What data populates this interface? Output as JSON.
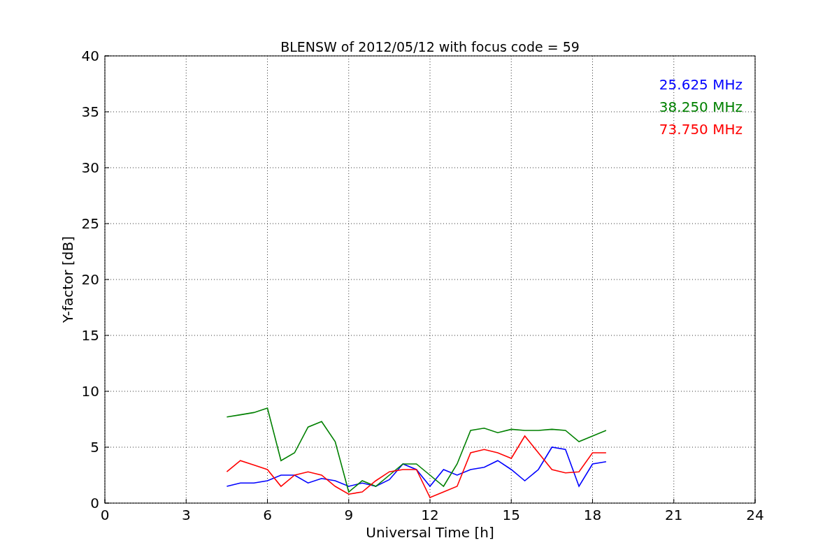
{
  "chart_data": {
    "type": "line",
    "title": "BLENSW of 2012/05/12 with focus code = 59",
    "xlabel": "Universal Time [h]",
    "ylabel": "Y-factor [dB]",
    "x": [
      4.5,
      5,
      5.5,
      6,
      6.5,
      7,
      7.5,
      8,
      8.5,
      9,
      9.5,
      10,
      10.5,
      11,
      11.5,
      12,
      12.5,
      13,
      13.5,
      14,
      14.5,
      15,
      15.5,
      16,
      16.5,
      17,
      17.5,
      18,
      18.5
    ],
    "series": [
      {
        "name": "25.625 MHz",
        "color": "#0000ff",
        "values": [
          1.5,
          1.8,
          1.8,
          2.0,
          2.5,
          2.5,
          1.8,
          2.2,
          2.0,
          1.5,
          1.8,
          1.5,
          2.1,
          3.5,
          3.0,
          1.5,
          3.0,
          2.5,
          3.0,
          3.2,
          3.8,
          3.0,
          2.0,
          3.0,
          5.0,
          4.8,
          1.5,
          3.5,
          3.7
        ]
      },
      {
        "name": "38.250 MHz",
        "color": "#008000",
        "values": [
          7.7,
          7.9,
          8.1,
          8.5,
          3.8,
          4.5,
          6.8,
          7.3,
          5.5,
          1.0,
          2.0,
          1.5,
          2.5,
          3.5,
          3.5,
          2.5,
          1.5,
          3.5,
          6.5,
          6.7,
          6.3,
          6.6,
          6.5,
          6.5,
          6.6,
          6.5,
          5.5,
          6.0,
          6.5
        ]
      },
      {
        "name": "73.750 MHz",
        "color": "#ff0000",
        "values": [
          2.8,
          3.8,
          3.4,
          3.0,
          1.5,
          2.5,
          2.8,
          2.5,
          1.5,
          0.8,
          1.0,
          2.0,
          2.8,
          3.0,
          3.0,
          0.5,
          1.0,
          1.5,
          4.5,
          4.8,
          4.5,
          4.0,
          6.0,
          4.5,
          3.0,
          2.7,
          2.8,
          4.5,
          4.5
        ]
      }
    ],
    "grid": true,
    "xlim": [
      0,
      24
    ],
    "ylim": [
      0,
      40
    ],
    "xticks": [
      0,
      3,
      6,
      9,
      12,
      15,
      18,
      21,
      24
    ],
    "yticks": [
      0,
      5,
      10,
      15,
      20,
      25,
      30,
      35,
      40
    ]
  }
}
